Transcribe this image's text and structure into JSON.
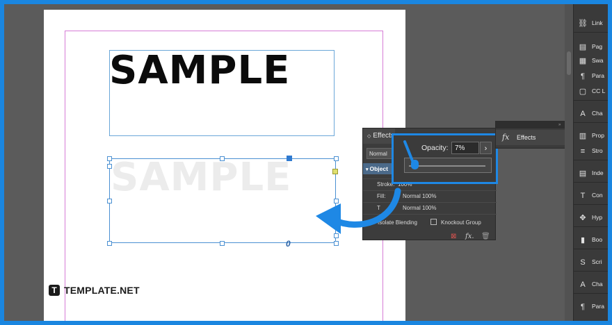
{
  "document": {
    "heading_text": "SAMPLE",
    "faded_text": "SAMPLE",
    "link_glyph": "0"
  },
  "effects_panel": {
    "tab_label": "Effects",
    "blend_mode": "Normal",
    "object_label": "Object",
    "stroke_label": "Stroke:",
    "stroke_value": "100%",
    "fill_label": "Fill:",
    "fill_value": "Normal 100%",
    "text_label": "T",
    "text_value": "Normal 100%",
    "isolate_label": "Isolate Blending",
    "knockout_label": "Knockout Group",
    "footer_icons": [
      "clear-effects-icon",
      "fx-icon",
      "trash-icon"
    ],
    "footer_fx_text": "fx."
  },
  "opacity": {
    "label": "Opacity:",
    "value": "7%",
    "slider_level": 0.07
  },
  "fx_panel": {
    "header_arrows": "»",
    "close_glyph": "✕",
    "icon_text": "fx",
    "label": "Effects"
  },
  "dock": {
    "items": [
      {
        "icon": "link-icon",
        "glyph": "⛓",
        "label": "Link"
      },
      {
        "icon": "pages-icon",
        "glyph": "▤",
        "label": "Pag"
      },
      {
        "icon": "swatches-icon",
        "glyph": "▦",
        "label": "Swa"
      },
      {
        "icon": "paragraph-icon",
        "glyph": "¶",
        "label": "Para"
      },
      {
        "icon": "cc-libraries-icon",
        "glyph": "▢",
        "label": "CC L"
      },
      {
        "icon": "character-icon",
        "glyph": "A",
        "label": "Cha"
      },
      {
        "icon": "properties-icon",
        "glyph": "▥",
        "label": "Prop"
      },
      {
        "icon": "stroke-icon",
        "glyph": "≡",
        "label": "Stro"
      },
      {
        "icon": "index-icon",
        "glyph": "▤",
        "label": "Inde"
      },
      {
        "icon": "conditional-text-icon",
        "glyph": "T",
        "label": "Con"
      },
      {
        "icon": "hyperlinks-icon",
        "glyph": "✥",
        "label": "Hyp"
      },
      {
        "icon": "bookmarks-icon",
        "glyph": "▮",
        "label": "Boo"
      },
      {
        "icon": "scripts-icon",
        "glyph": "S",
        "label": "Scri"
      },
      {
        "icon": "character-styles-icon",
        "glyph": "A",
        "label": "Cha"
      },
      {
        "icon": "paragraph-styles-icon",
        "glyph": "¶",
        "label": "Para"
      }
    ]
  },
  "watermark": {
    "mark": "T",
    "text": "TEMPLATE.NET"
  },
  "colors": {
    "accent": "#1e88e5",
    "panel_bg": "#3c3c3c",
    "pasteboard": "#5b5b5b"
  }
}
